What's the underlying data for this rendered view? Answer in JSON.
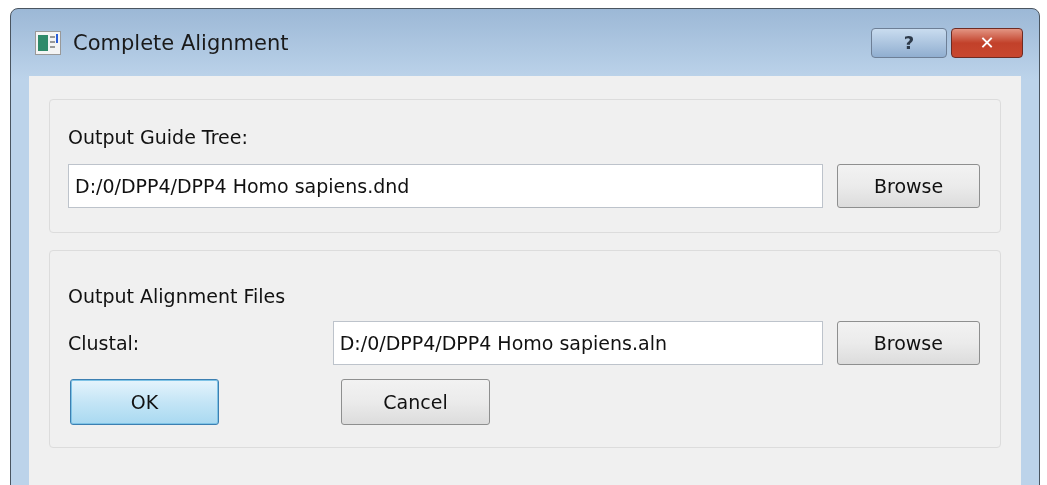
{
  "window": {
    "title": "Complete Alignment",
    "controls": [
      {
        "kind": "help",
        "label": "?"
      },
      {
        "kind": "close",
        "label": "✕"
      }
    ]
  },
  "guide_tree": {
    "label": "Output Guide Tree:",
    "value": "D:/0/DPP4/DPP4 Homo sapiens.dnd",
    "button": "Browse"
  },
  "alignment_files": {
    "label": "Output Alignment Files",
    "field_label": "Clustal:",
    "value": "D:/0/DPP4/DPP4 Homo sapiens.aln",
    "button": "Browse"
  },
  "buttons": [
    {
      "label": "OK",
      "default": true
    },
    {
      "label": "Cancel",
      "default": false
    }
  ]
}
